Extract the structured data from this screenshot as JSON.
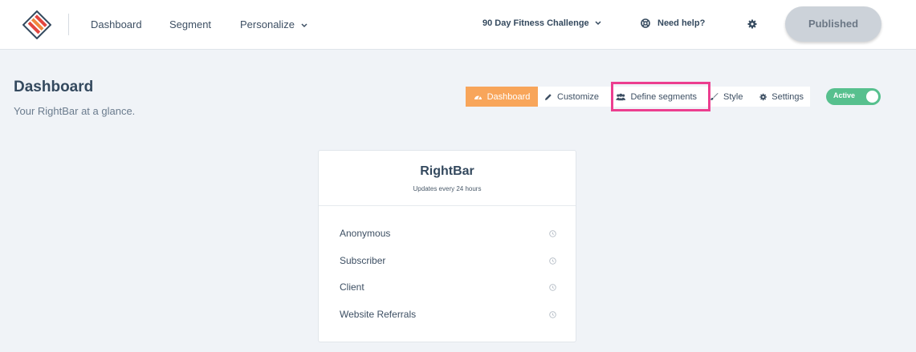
{
  "nav": {
    "links": [
      "Dashboard",
      "Segment",
      "Personalize"
    ],
    "campaign": "90 Day Fitness Challenge",
    "help": "Need help?",
    "publish_label": "Published"
  },
  "page": {
    "title": "Dashboard",
    "subtitle": "Your RightBar at a glance."
  },
  "tabs": {
    "dashboard": "Dashboard",
    "customize": "Customize",
    "segments": "Define segments",
    "style": "Style",
    "settings": "Settings"
  },
  "status": {
    "label": "Active",
    "on": true
  },
  "card": {
    "title": "RightBar",
    "subtitle": "Updates every 24 hours",
    "segments": [
      "Anonymous",
      "Subscriber",
      "Client",
      "Website Referrals"
    ]
  },
  "colors": {
    "accent": "#f8a55a",
    "highlight": "#ec3e8f",
    "toggle": "#57c08e",
    "logo_red": "#e2463f",
    "logo_orange": "#f08a3e"
  },
  "icons": [
    "logo-icon",
    "chevron-down-icon",
    "lifebuoy-icon",
    "gear-icon",
    "dashboard-gauge-icon",
    "pencil-icon",
    "users-icon",
    "brush-icon",
    "info-icon"
  ]
}
